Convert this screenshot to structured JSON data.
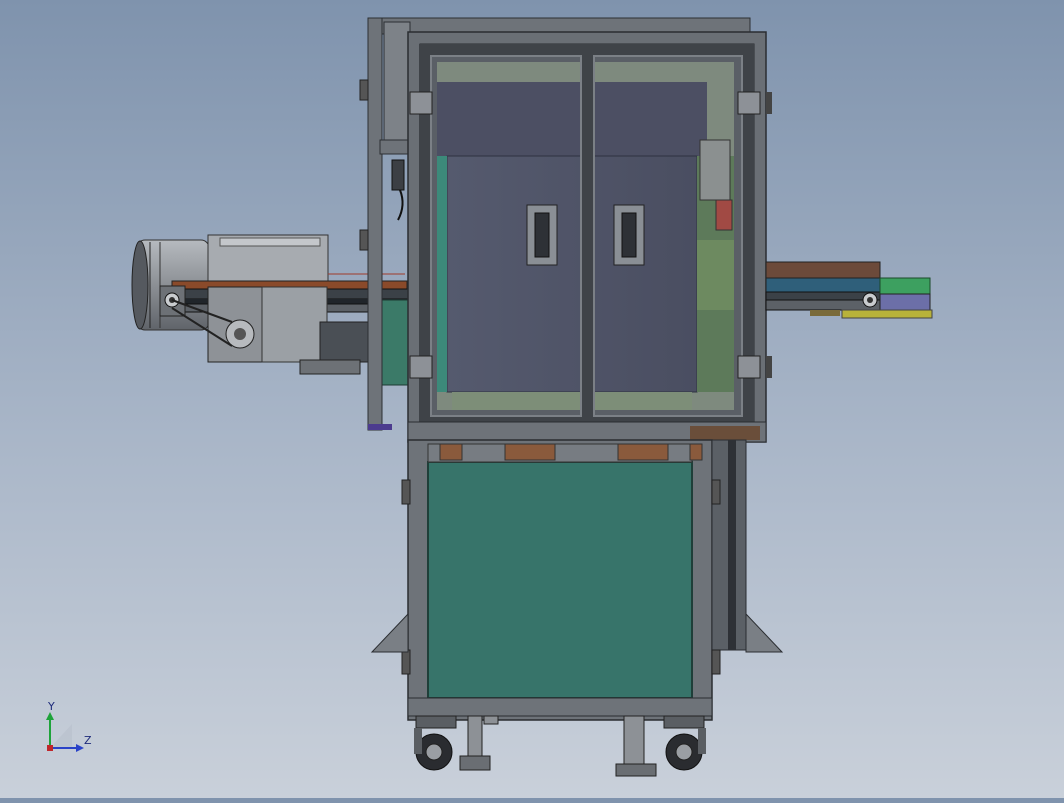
{
  "scene": {
    "background": [
      "#7f93ad",
      "#c9d0da"
    ],
    "colors": {
      "frame": "#6e7379",
      "frame_dark": "#44484d",
      "panel_glass": "#4f5366",
      "cabinet_panel": "#37746a",
      "copper": "#8a5a3c",
      "conveyor_belt": "#2f3a44",
      "motor": "#9a9ea3",
      "green_part": "#3da060"
    }
  },
  "triad": {
    "y_label": "Y",
    "z_label": "Z",
    "y_color": "#1ea33a",
    "z_color": "#2a43c8",
    "origin_color": "#c0262b"
  }
}
